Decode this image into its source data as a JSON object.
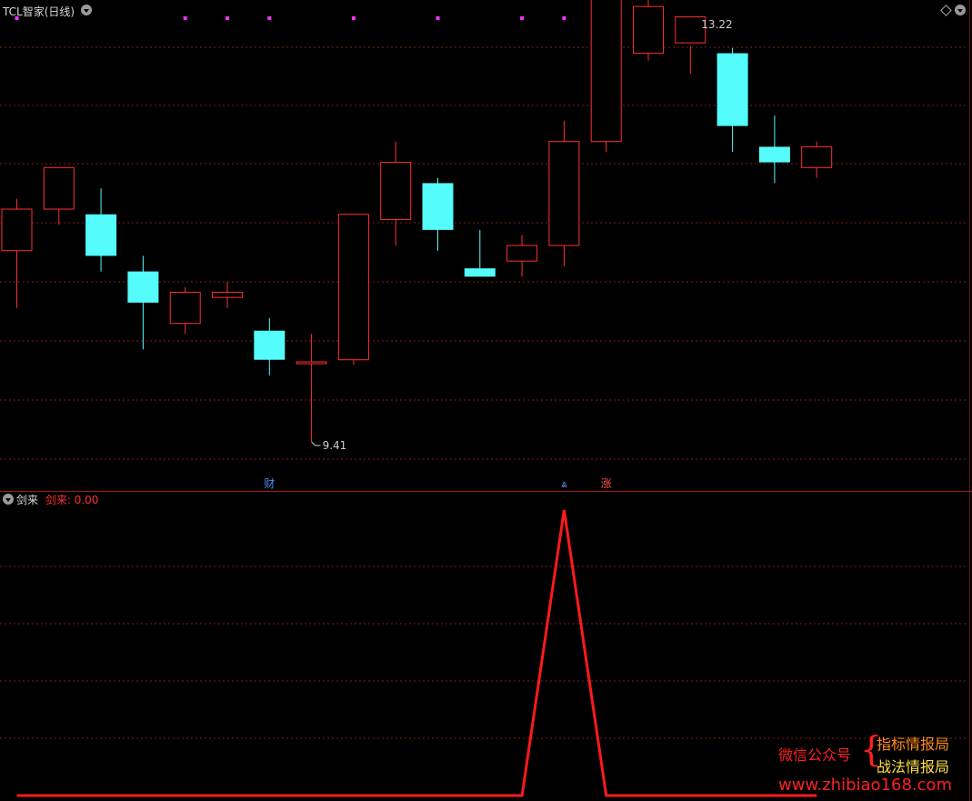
{
  "main": {
    "title": "TCL智家(日线)",
    "high_label": "13.22",
    "low_label": "9.41",
    "price_range": [
      9.2,
      13.4
    ],
    "candles": [
      {
        "o": 11.25,
        "h": 11.75,
        "l": 10.7,
        "c": 11.65
      },
      {
        "o": 11.65,
        "h": 11.95,
        "l": 11.5,
        "c": 12.05
      },
      {
        "o": 11.6,
        "h": 11.85,
        "l": 11.05,
        "c": 11.2
      },
      {
        "o": 11.05,
        "h": 11.2,
        "l": 10.3,
        "c": 10.75
      },
      {
        "o": 10.55,
        "h": 10.9,
        "l": 10.45,
        "c": 10.85
      },
      {
        "o": 10.8,
        "h": 10.95,
        "l": 10.7,
        "c": 10.85
      },
      {
        "o": 10.48,
        "h": 10.6,
        "l": 10.05,
        "c": 10.2
      },
      {
        "o": 10.18,
        "h": 10.45,
        "l": 9.41,
        "c": 10.18
      },
      {
        "o": 10.2,
        "h": 11.6,
        "l": 10.15,
        "c": 11.6
      },
      {
        "o": 11.55,
        "h": 12.3,
        "l": 11.3,
        "c": 12.1
      },
      {
        "o": 11.9,
        "h": 11.95,
        "l": 11.25,
        "c": 11.45
      },
      {
        "o": 11.08,
        "h": 11.45,
        "l": 11.0,
        "c": 11.0
      },
      {
        "o": 11.15,
        "h": 11.4,
        "l": 11.0,
        "c": 11.3
      },
      {
        "o": 11.3,
        "h": 12.5,
        "l": 11.1,
        "c": 12.3
      },
      {
        "o": 12.3,
        "h": 13.95,
        "l": 12.2,
        "c": 13.8
      },
      {
        "o": 13.15,
        "h": 14.2,
        "l": 13.08,
        "c": 13.6
      },
      {
        "o": 13.25,
        "h": 13.22,
        "l": 12.95,
        "c": 13.5
      },
      {
        "o": 13.15,
        "h": 13.2,
        "l": 12.2,
        "c": 12.45
      },
      {
        "o": 12.25,
        "h": 12.55,
        "l": 11.9,
        "c": 12.1
      },
      {
        "o": 12.05,
        "h": 12.3,
        "l": 11.95,
        "c": 12.25
      }
    ],
    "markers": [
      {
        "index": 6,
        "text": "财",
        "color": "#4a90ff"
      },
      {
        "index": 13,
        "text": "⩓",
        "color": "#5aa0ff"
      },
      {
        "index": 14,
        "text": "涨",
        "color": "#ff5050"
      }
    ],
    "top_dots": [
      0,
      4,
      5,
      6,
      8,
      10,
      12,
      13,
      14,
      15
    ],
    "colors": {
      "up": "#ff3030",
      "down": "#54fcfc",
      "grid": "#8a1a1a",
      "dot": "#ff30ff"
    }
  },
  "sub": {
    "title": "剑来",
    "value_label": "剑来: 0.00",
    "range": [
      0,
      1
    ],
    "values": [
      0,
      0,
      0,
      0,
      0,
      0,
      0,
      0,
      0,
      0,
      0,
      0,
      0,
      1,
      0,
      0,
      0,
      0,
      0,
      0
    ],
    "line_color": "#ff1a1a"
  },
  "watermark": {
    "wechat_label": "微信公众号",
    "brace": "{",
    "line1": "指标情报局",
    "line2": "战法情报局",
    "url": "www.zhibiao168.com"
  }
}
